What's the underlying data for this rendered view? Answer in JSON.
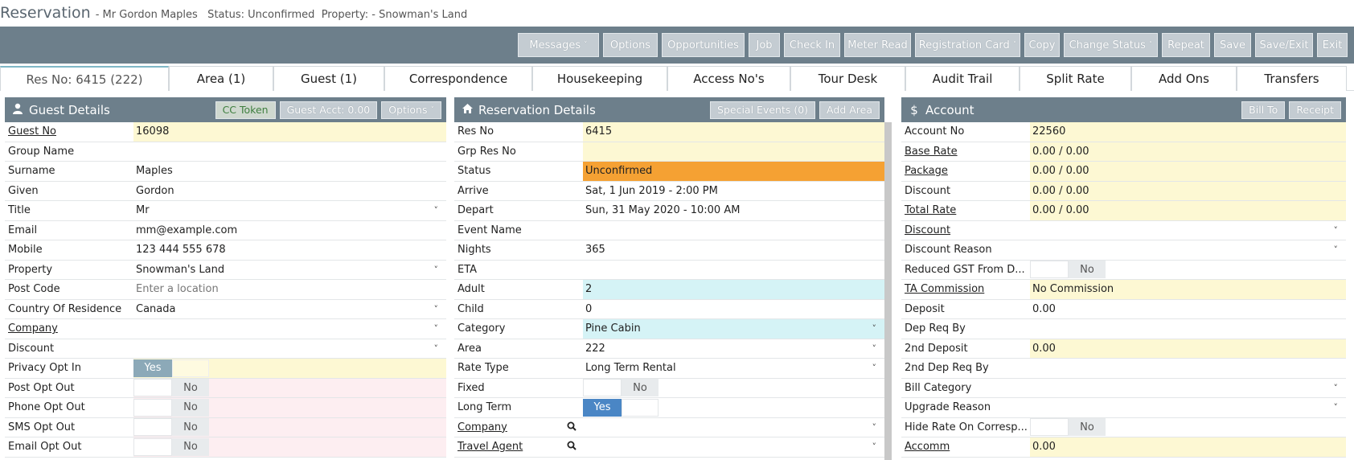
{
  "header": {
    "title": "Reservation",
    "subtitle": "- Mr Gordon Maples   Status: Unconfirmed  Property: - Snowman's Land"
  },
  "toolbar": [
    {
      "label": "Messages",
      "dropdown": true,
      "width": 101
    },
    {
      "label": "Options",
      "dropdown": false,
      "width": 68
    },
    {
      "label": "Opportunities",
      "dropdown": false,
      "width": 103
    },
    {
      "label": "Job",
      "dropdown": false,
      "width": 39
    },
    {
      "label": "Check In",
      "dropdown": false,
      "width": 70
    },
    {
      "label": "Meter Read",
      "dropdown": false,
      "width": 83
    },
    {
      "label": "Registration Card",
      "dropdown": true,
      "width": 131
    },
    {
      "label": "Copy",
      "dropdown": false,
      "width": 44
    },
    {
      "label": "Change Status",
      "dropdown": true,
      "width": 117
    },
    {
      "label": "Repeat",
      "dropdown": false,
      "width": 60
    },
    {
      "label": "Save",
      "dropdown": false,
      "width": 46
    },
    {
      "label": "Save/Exit",
      "dropdown": false,
      "width": 72
    },
    {
      "label": "Exit",
      "dropdown": false,
      "width": 38
    }
  ],
  "tabs": [
    {
      "label": "Res No: 6415 (222)",
      "active": true
    },
    {
      "label": "Area (1)"
    },
    {
      "label": "Guest (1)"
    },
    {
      "label": "Correspondence"
    },
    {
      "label": "Housekeeping"
    },
    {
      "label": "Access No's"
    },
    {
      "label": "Tour Desk"
    },
    {
      "label": "Audit Trail"
    },
    {
      "label": "Split Rate"
    },
    {
      "label": "Add Ons"
    },
    {
      "label": "Transfers"
    }
  ],
  "guest": {
    "title": "Guest Details",
    "icon": "user-icon",
    "buttons": [
      {
        "label": "CC Token",
        "style": "green"
      },
      {
        "label": "Guest Acct: 0.00"
      },
      {
        "label": "Options",
        "dropdown": true
      }
    ],
    "rows": [
      {
        "label": "Guest No",
        "link": true,
        "value": "16098",
        "bg": "yellow"
      },
      {
        "label": "Group Name",
        "value": ""
      },
      {
        "label": "Surname",
        "value": "Maples"
      },
      {
        "label": "Given",
        "value": "Gordon"
      },
      {
        "label": "Title",
        "value": "Mr",
        "dd": true
      },
      {
        "label": "Email",
        "value": "mm@example.com"
      },
      {
        "label": "Mobile",
        "value": "123 444 555 678"
      },
      {
        "label": "Property",
        "value": "Snowman's Land",
        "dd": true
      },
      {
        "label": "Post Code",
        "placeholder": "Enter a location"
      },
      {
        "label": "Country Of Residence",
        "value": "Canada",
        "dd": true
      },
      {
        "label": "Company",
        "link": true,
        "value": "",
        "dd": true
      },
      {
        "label": "Discount",
        "value": "",
        "dd": true
      },
      {
        "label": "Privacy Opt In",
        "toggle": "yes",
        "toggle_text": "Yes",
        "bg": "yellow"
      },
      {
        "label": "Post Opt Out",
        "toggle": "no",
        "toggle_text": "No",
        "bg": "pink"
      },
      {
        "label": "Phone Opt Out",
        "toggle": "no",
        "toggle_text": "No",
        "bg": "pink"
      },
      {
        "label": "SMS Opt Out",
        "toggle": "no",
        "toggle_text": "No",
        "bg": "pink"
      },
      {
        "label": "Email Opt Out",
        "toggle": "no",
        "toggle_text": "No",
        "bg": "pink"
      }
    ]
  },
  "reservation": {
    "title": "Reservation Details",
    "icon": "home-icon",
    "buttons": [
      {
        "label": "Special Events (0)"
      },
      {
        "label": "Add Area"
      }
    ],
    "rows": [
      {
        "label": "Res No",
        "value": "6415",
        "bg": "yellow"
      },
      {
        "label": "Grp Res No",
        "value": "",
        "bg": "yellow"
      },
      {
        "label": "Status",
        "value": "Unconfirmed",
        "bg": "orange"
      },
      {
        "label": "Arrive",
        "value": "Sat, 1 Jun 2019 - 2:00 PM"
      },
      {
        "label": "Depart",
        "value": "Sun, 31 May 2020 - 10:00 AM"
      },
      {
        "label": "Event Name",
        "value": ""
      },
      {
        "label": "Nights",
        "value": "365"
      },
      {
        "label": "ETA",
        "value": ""
      },
      {
        "label": "Adult",
        "value": "2",
        "bg": "cyan"
      },
      {
        "label": "Child",
        "value": "0"
      },
      {
        "label": "Category",
        "value": "Pine Cabin",
        "bg": "cyan",
        "dd": true
      },
      {
        "label": "Area",
        "value": "222",
        "dd": true
      },
      {
        "label": "Rate Type",
        "value": "Long Term Rental",
        "dd": true
      },
      {
        "label": "Fixed",
        "toggle": "no",
        "toggle_text": "No"
      },
      {
        "label": "Long Term",
        "toggle": "yesb",
        "toggle_text": "Yes"
      },
      {
        "label": "Company",
        "link": true,
        "search": true,
        "value": "",
        "dd": true
      },
      {
        "label": "Travel Agent",
        "link": true,
        "search": true,
        "value": "",
        "dd": true
      }
    ]
  },
  "account": {
    "title": "Account",
    "icon": "dollar-icon",
    "buttons": [
      {
        "label": "Bill To"
      },
      {
        "label": "Receipt"
      }
    ],
    "rows": [
      {
        "label": "Account No",
        "value": "22560",
        "bg": "yellow"
      },
      {
        "label": "Base Rate",
        "link": true,
        "value": "0.00 / 0.00",
        "bg": "yellow"
      },
      {
        "label": "Package",
        "link": true,
        "value": "0.00 / 0.00",
        "bg": "yellow"
      },
      {
        "label": "Discount",
        "value": "0.00 / 0.00",
        "bg": "yellow"
      },
      {
        "label": "Total Rate",
        "link": true,
        "value": "0.00 / 0.00",
        "bg": "yellow"
      },
      {
        "label": "Discount",
        "link": true,
        "value": "",
        "dd": true
      },
      {
        "label": "Discount Reason",
        "value": "",
        "dd": true
      },
      {
        "label": "Reduced GST From D...",
        "toggle": "no",
        "toggle_text": "No"
      },
      {
        "label": "TA Commission",
        "link": true,
        "value": "No Commission",
        "bg": "yellow"
      },
      {
        "label": "Deposit",
        "value": "0.00"
      },
      {
        "label": "Dep Req By",
        "value": ""
      },
      {
        "label": "2nd Deposit",
        "value": "0.00",
        "bg": "yellow"
      },
      {
        "label": "2nd Dep Req By",
        "value": ""
      },
      {
        "label": "Bill Category",
        "value": "",
        "dd": true
      },
      {
        "label": "Upgrade Reason",
        "value": "",
        "dd": true
      },
      {
        "label": "Hide Rate On Corresp...",
        "toggle": "no",
        "toggle_text": "No"
      },
      {
        "label": "Accomm",
        "link": true,
        "value": "0.00",
        "bg": "yellow"
      }
    ]
  }
}
